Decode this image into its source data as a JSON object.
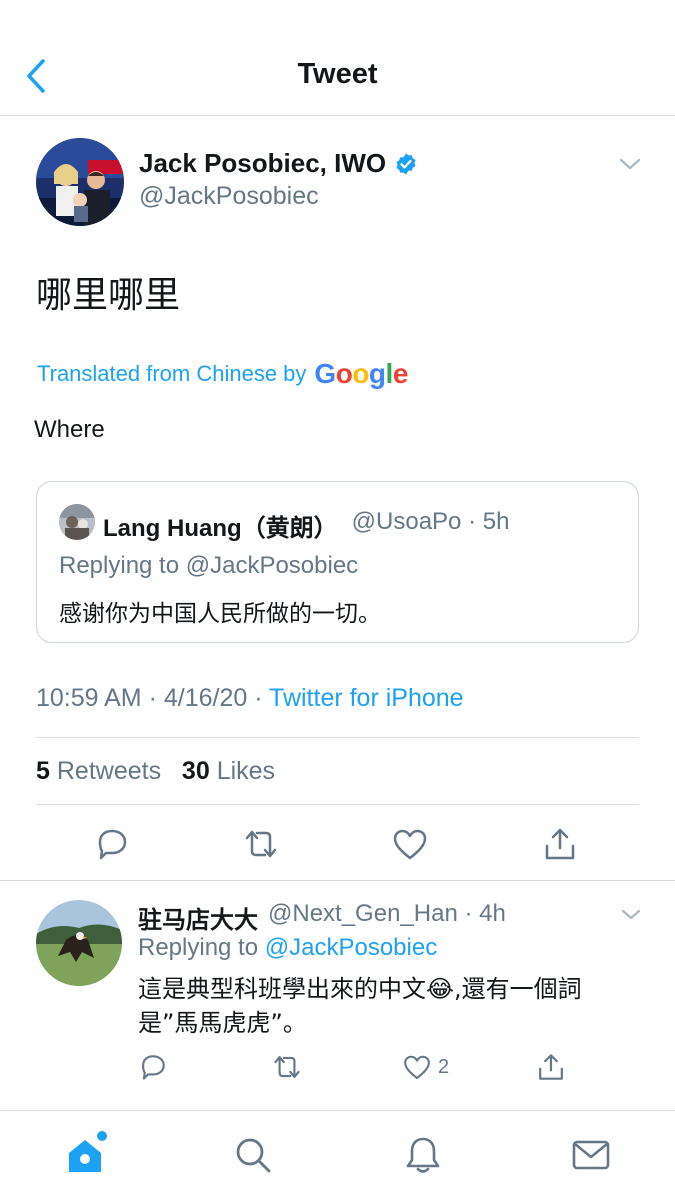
{
  "header": {
    "title": "Tweet"
  },
  "tweet": {
    "author_name": "Jack Posobiec, IWO",
    "author_handle": "@JackPosobiec",
    "text": "哪里哪里",
    "translated_label": "Translated from Chinese by",
    "translated_brand": "Google",
    "translation": "Where",
    "time": "10:59 AM",
    "date": "4/16/20",
    "source": "Twitter for iPhone",
    "retweets_count": "5",
    "retweets_label": "Retweets",
    "likes_count": "30",
    "likes_label": "Likes"
  },
  "quote": {
    "name": "Lang Huang（黄朗）",
    "handle": "@UsoaPo",
    "age": "5h",
    "replying_to": "Replying to @JackPosobiec",
    "text": "感谢你为中国人民所做的一切。"
  },
  "reply": {
    "name": "驻马店大大",
    "handle": "@Next_Gen_Han",
    "age": "4h",
    "replying_prefix": "Replying to",
    "replying_mention": "@JackPosobiec",
    "text": "這是典型科班學出來的中文😂,還有一個詞是”馬馬虎虎”。",
    "likes": "2"
  },
  "colors": {
    "accent": "#1da1f2",
    "muted": "#657786",
    "text": "#14171a",
    "divider": "#d8dde2"
  },
  "icons": {
    "back": "chevron-left-icon",
    "verified": "verified-badge-icon",
    "caret": "chevron-down-icon",
    "reply": "comment-icon",
    "retweet": "retweet-icon",
    "like": "heart-icon",
    "share": "share-icon",
    "tabs": [
      "home-icon",
      "search-icon",
      "bell-icon",
      "mail-icon"
    ]
  }
}
